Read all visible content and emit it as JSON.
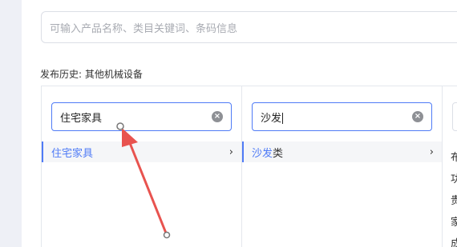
{
  "search": {
    "placeholder": "可输入产品名称、类目关键词、条码信息"
  },
  "history": {
    "text": "发布历史: 其他机械设备"
  },
  "columns": [
    {
      "input_value": "住宅家具",
      "result_highlight": "住宅家具",
      "result_rest": ""
    },
    {
      "input_value": "沙发",
      "result_highlight": "沙发",
      "result_rest": "类"
    }
  ],
  "col3": {
    "items": [
      "布",
      "功",
      "贵",
      "家",
      "成"
    ]
  },
  "colors": {
    "accent": "#4f7bf6",
    "annotation_arrow": "#e8534f"
  }
}
